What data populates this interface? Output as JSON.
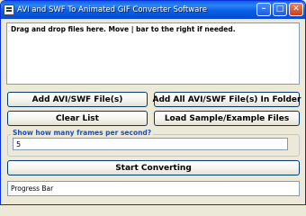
{
  "window": {
    "title": "AVI and SWF To Animated GIF Converter Software",
    "icon": "app-icon",
    "controls": {
      "minimize_icon": "minimize-icon",
      "maximize_icon": "maximize-icon",
      "close_icon": "close-icon"
    }
  },
  "file_list": {
    "instructions": "Drag and drop files here. Move | bar to the right if needed."
  },
  "buttons": {
    "add_files": "Add AVI/SWF File(s)",
    "add_all_folder": "Add All AVI/SWF File(s) In Folder",
    "clear_list": "Clear List",
    "load_sample": "Load Sample/Example Files",
    "start_converting": "Start Converting"
  },
  "fps": {
    "label": "Show how many frames per second?",
    "value": "5"
  },
  "progress": {
    "label": "Progress Bar"
  },
  "colors": {
    "titlebar": "#0a5fe8",
    "window_bg": "#ece9d8",
    "group_label": "#1f4fb0"
  }
}
